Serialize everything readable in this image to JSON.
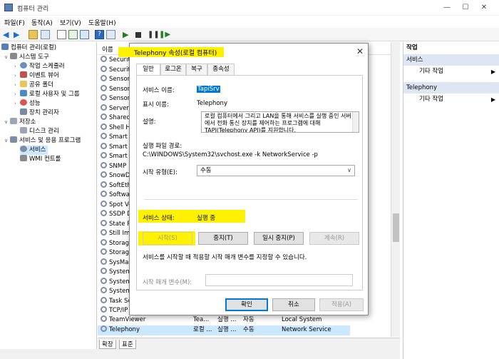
{
  "window": {
    "title": "컴퓨터 관리"
  },
  "menu": [
    "파일(F)",
    "동작(A)",
    "보기(V)",
    "도움말(H)"
  ],
  "tree": {
    "root": "컴퓨터 관리(로컬)",
    "system_tools": "시스템 도구",
    "task_scheduler": "작업 스케줄러",
    "event_viewer": "이벤트 뷰어",
    "shared_folders": "공유 폴더",
    "local_users": "로컬 사용자 및 그룹",
    "performance": "성능",
    "device_manager": "장치 관리자",
    "storage": "저장소",
    "disk_management": "디스크 관리",
    "services_apps": "서비스 및 응용 프로그램",
    "services": "서비스",
    "wmi": "WMI 컨트롤"
  },
  "list": {
    "header_name": "이름",
    "rows": [
      "Security",
      "Security",
      "Sensor",
      "Sensor",
      "Sensor",
      "Server",
      "Shared",
      "Shell H",
      "Smart C",
      "Smart C",
      "Smart C",
      "SNMP",
      "SnowD",
      "SoftEth",
      "Softwa",
      "Spot Ve",
      "SSDP D",
      "State R",
      "Still Im",
      "Storage",
      "Storage",
      "SysMai",
      "System",
      "System",
      "System",
      "Task Sc",
      "TCP/IP"
    ],
    "full_rows": [
      {
        "name": "TeamViewer",
        "desc": "Tea...",
        "status": "실행 ...",
        "startup": "자동",
        "logon": "Local System"
      },
      {
        "name": "Telephony",
        "desc": "로컬 ...",
        "status": "실행 ...",
        "startup": "수동",
        "logon": "Network Service"
      }
    ]
  },
  "bottom_tabs": [
    "확장",
    "표준"
  ],
  "actions": {
    "header": "작업",
    "section1": "서비스",
    "section1_item": "기타 작업",
    "section2": "Telephony",
    "section2_item": "기타 작업"
  },
  "dialog": {
    "title": "Telephony 속성(로컬 컴퓨터)",
    "tabs": [
      "일반",
      "로그온",
      "복구",
      "종속성"
    ],
    "service_name_label": "서비스 이름:",
    "service_name_value": "TapiSrv",
    "display_name_label": "표시 이름:",
    "display_name_value": "Telephony",
    "desc_label": "설명:",
    "desc_value": "로컬 컴퓨터에서 그리고 LAN을 통해 서비스를 실행 중인 서버에서 전화 통신 장치를 제어하는 프로그램에 대해 TAPI(Telephony API)를 지원합니다.",
    "path_label": "실행 파일 경로:",
    "path_value": "C:\\WINDOWS\\System32\\svchost.exe -k NetworkService -p",
    "startup_label": "시작 유형(E):",
    "startup_value": "수동",
    "status_label": "서비스 상태:",
    "status_value": "실행 중",
    "btn_start": "시작(S)",
    "btn_stop": "중지(T)",
    "btn_pause": "일시 중지(P)",
    "btn_resume": "계속(R)",
    "hint": "서비스를 시작할 때 적용할 시작 매개 변수를 지정할 수 있습니다.",
    "param_label": "시작 매개 변수(M):",
    "btn_ok": "확인",
    "btn_cancel": "취소",
    "btn_apply": "적용(A)"
  },
  "colors": {
    "highlight": "#fff200",
    "selection": "#cce8ff",
    "action_section": "#dde6f2"
  }
}
